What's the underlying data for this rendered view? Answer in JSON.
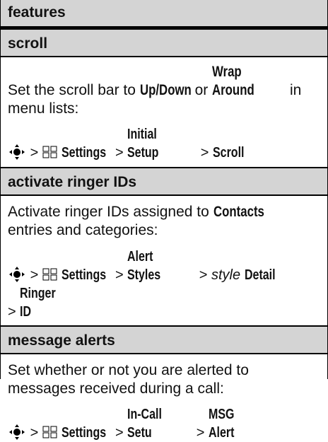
{
  "header": {
    "title": "features"
  },
  "sections": [
    {
      "title": "scroll",
      "desc_line1_a": "Set the scroll bar to ",
      "desc_line1_b": "Up/Down",
      "desc_line1_c": " or ",
      "desc_line1_d": "Wrap Around",
      "desc_line1_e": " in",
      "desc_line2": "menu lists:",
      "path": {
        "sep": ">",
        "settings": "Settings",
        "p1": "Initial Setup",
        "p2": "Scroll"
      }
    },
    {
      "title": "activate ringer IDs",
      "desc_line1_a": "Activate ringer IDs assigned to ",
      "desc_line1_b": "Contacts",
      "desc_line2": "entries and categories:",
      "path": {
        "sep": ">",
        "settings": "Settings",
        "p1": "Alert Styles",
        "p2_italic": "style",
        "p2_bold": "Detail",
        "p3": "Ringer ID"
      }
    },
    {
      "title": "message alerts",
      "desc_line1": "Set whether or not you are alerted to",
      "desc_line2": "messages received during a call:",
      "path": {
        "sep": ">",
        "settings": "Settings",
        "p1": "In-Call Setu",
        "p2": "MSG Alert"
      }
    }
  ]
}
